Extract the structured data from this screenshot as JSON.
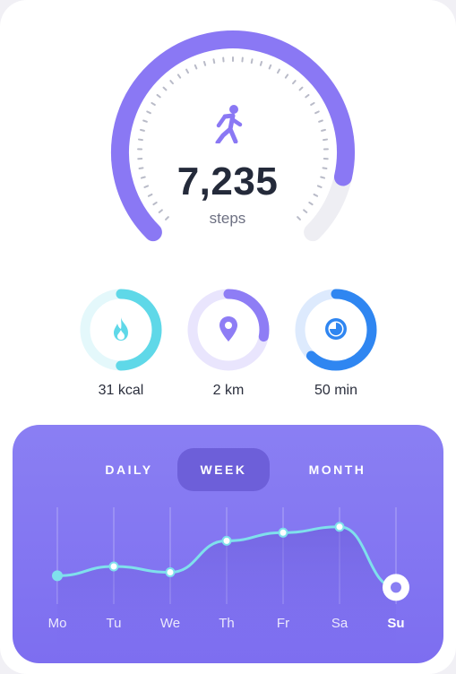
{
  "steps": {
    "value": "7,235",
    "label": "steps",
    "progress": 0.88,
    "icon": "walking-person-icon"
  },
  "stats": [
    {
      "id": "calories",
      "label": "31 kcal",
      "icon": "flame-icon",
      "progress": 0.5,
      "color": "#5fd8e8",
      "track": "#e4f8fb"
    },
    {
      "id": "distance",
      "label": "2 km",
      "icon": "location-pin-icon",
      "progress": 0.28,
      "color": "#8e7df5",
      "track": "#e9e5fd"
    },
    {
      "id": "duration",
      "label": "50 min",
      "icon": "timer-icon",
      "progress": 0.62,
      "color": "#2f86f1",
      "track": "#ddeafd"
    }
  ],
  "tabs": [
    {
      "label": "DAILY",
      "active": false
    },
    {
      "label": "WEEK",
      "active": true
    },
    {
      "label": "MONTH",
      "active": false
    }
  ],
  "chart_data": {
    "type": "line",
    "categories": [
      "Mo",
      "Tu",
      "We",
      "Th",
      "Fr",
      "Sa",
      "Su"
    ],
    "values": [
      3.2,
      4.0,
      3.5,
      6.2,
      6.9,
      7.4,
      2.2
    ],
    "ylim": [
      0,
      10
    ],
    "grid": "vertical lines per day",
    "highlight": "Su"
  },
  "colors": {
    "accent": "#8a78f4",
    "panel": "#8a7ff3",
    "active_tab": "#6d5fd9",
    "line": "#7fe0ec"
  }
}
